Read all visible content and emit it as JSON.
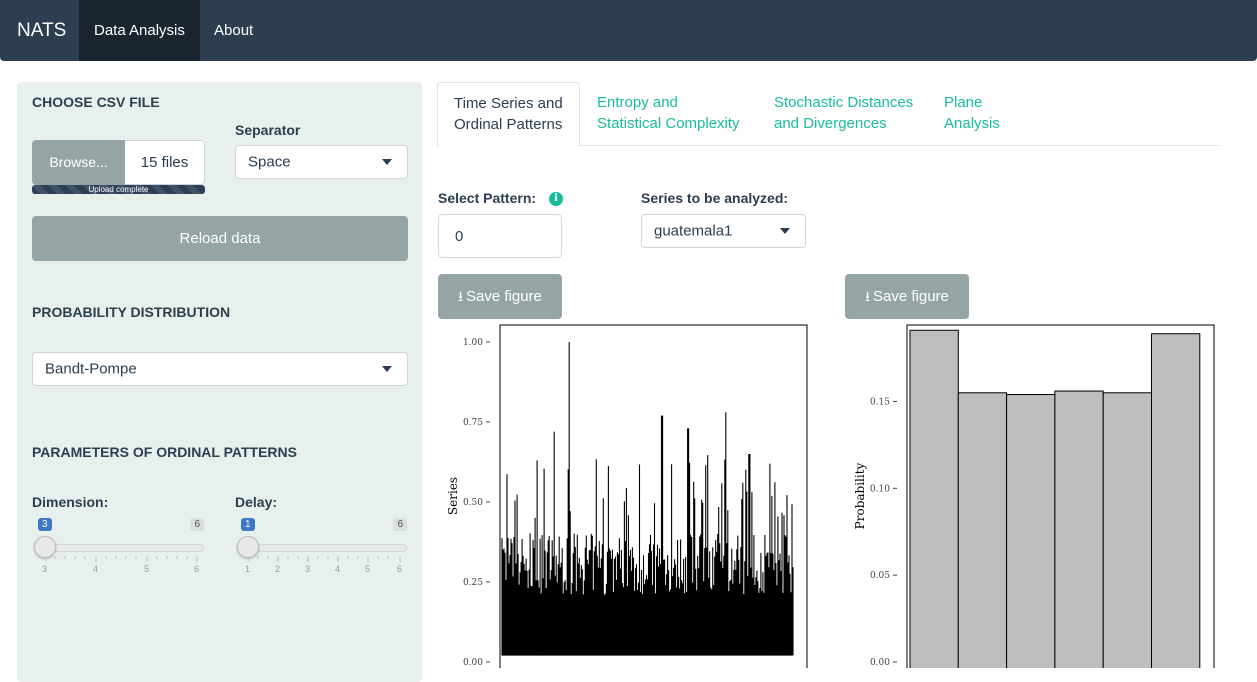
{
  "navbar": {
    "brand": "NATS",
    "items": [
      "Data Analysis",
      "About"
    ]
  },
  "sidebar": {
    "csv_title": "CHOOSE CSV FILE",
    "browse_label": "Browse...",
    "files_count": "15 files",
    "upload_status": "Upload complete",
    "separator_label": "Separator",
    "separator_value": "Space",
    "reload_label": "Reload data",
    "prob_title": "PROBABILITY DISTRIBUTION",
    "prob_value": "Bandt-Pompe",
    "params_title": "PARAMETERS OF ORDINAL PATTERNS",
    "dimension": {
      "label": "Dimension:",
      "value": "3",
      "max": "6",
      "ticks": [
        "3",
        "4",
        "5",
        "6"
      ]
    },
    "delay": {
      "label": "Delay:",
      "value": "1",
      "max": "6",
      "ticks": [
        "1",
        "2",
        "3",
        "4",
        "5",
        "6"
      ]
    }
  },
  "tabs": [
    {
      "line1": "Time Series and",
      "line2": "Ordinal Patterns"
    },
    {
      "line1": "Entropy and",
      "line2": "Statistical Complexity"
    },
    {
      "line1": "Stochastic Distances",
      "line2": "and Divergences"
    },
    {
      "line1": "Plane",
      "line2": "Analysis"
    }
  ],
  "controls": {
    "pattern_label": "Select Pattern:",
    "pattern_value": "0",
    "series_label": "Series to be analyzed:",
    "series_value": "guatemala1",
    "save_label": "Save figure"
  },
  "colors": {
    "navbar": "#2c3e50",
    "accent": "#18bc9c",
    "sidebar_bg": "#e8f0ee",
    "button": "#95a5a6"
  },
  "chart_data": [
    {
      "type": "line",
      "ylabel": "Series",
      "ylim": [
        0,
        1
      ],
      "yticks": [
        "0.00",
        "0.25",
        "0.50",
        "0.75",
        "1.00"
      ],
      "baseline_low": 0.02,
      "typical_high": 0.35,
      "peaks": [
        {
          "x": 0.18,
          "y": 0.72
        },
        {
          "x": 0.23,
          "y": 1.0
        },
        {
          "x": 0.55,
          "y": 0.77
        },
        {
          "x": 0.64,
          "y": 0.73
        },
        {
          "x": 0.77,
          "y": 0.78
        },
        {
          "x": 0.85,
          "y": 0.65
        },
        {
          "x": 0.12,
          "y": 0.63
        },
        {
          "x": 0.92,
          "y": 0.62
        }
      ]
    },
    {
      "type": "bar",
      "ylabel": "Probability",
      "ylim": [
        0,
        0.19
      ],
      "yticks": [
        "0.00",
        "0.05",
        "0.10",
        "0.15"
      ],
      "values": [
        0.191,
        0.155,
        0.154,
        0.156,
        0.155,
        0.189
      ]
    }
  ]
}
